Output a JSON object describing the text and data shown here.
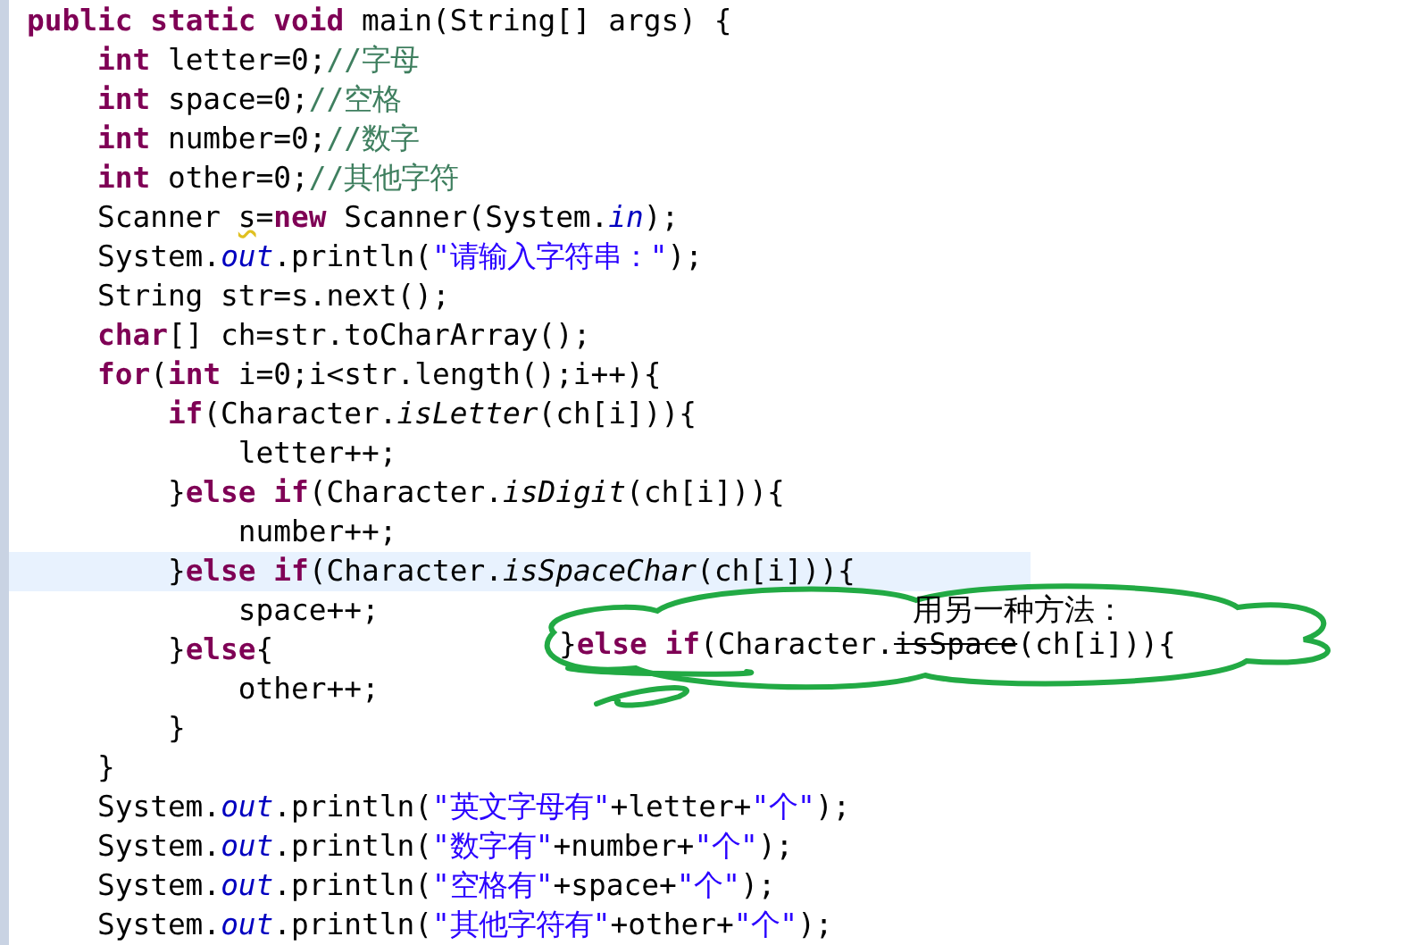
{
  "editor": {
    "lines": [
      {
        "current": false,
        "tokens": [
          {
            "kind": "keyword",
            "text": "public"
          },
          {
            "kind": "keyword",
            "text": " static"
          },
          {
            "kind": "keyword",
            "text": " void"
          },
          {
            "kind": "plain",
            "text": " main(String[] args) {"
          }
        ]
      },
      {
        "current": false,
        "tokens": [
          {
            "kind": "keyword",
            "text": "    int"
          },
          {
            "kind": "plain",
            "text": " letter=0;"
          },
          {
            "kind": "comment",
            "text": "//字母"
          }
        ]
      },
      {
        "current": false,
        "tokens": [
          {
            "kind": "keyword",
            "text": "    int"
          },
          {
            "kind": "plain",
            "text": " space=0;"
          },
          {
            "kind": "comment",
            "text": "//空格"
          }
        ]
      },
      {
        "current": false,
        "tokens": [
          {
            "kind": "keyword",
            "text": "    int"
          },
          {
            "kind": "plain",
            "text": " number=0;"
          },
          {
            "kind": "comment",
            "text": "//数字"
          }
        ]
      },
      {
        "current": false,
        "tokens": [
          {
            "kind": "keyword",
            "text": "    int"
          },
          {
            "kind": "plain",
            "text": " other=0;"
          },
          {
            "kind": "comment",
            "text": "//其他字符"
          }
        ]
      },
      {
        "current": false,
        "tokens": [
          {
            "kind": "plain",
            "text": "    Scanner "
          },
          {
            "kind": "warning",
            "text": "s"
          },
          {
            "kind": "plain",
            "text": "="
          },
          {
            "kind": "keyword",
            "text": "new"
          },
          {
            "kind": "plain",
            "text": " Scanner(System."
          },
          {
            "kind": "field",
            "text": "in"
          },
          {
            "kind": "plain",
            "text": ");"
          }
        ]
      },
      {
        "current": false,
        "tokens": [
          {
            "kind": "plain",
            "text": "    System."
          },
          {
            "kind": "field",
            "text": "out"
          },
          {
            "kind": "plain",
            "text": ".println("
          },
          {
            "kind": "string",
            "text": "\"请输入字符串：\""
          },
          {
            "kind": "plain",
            "text": ");"
          }
        ]
      },
      {
        "current": false,
        "tokens": [
          {
            "kind": "plain",
            "text": "    String str=s.next();"
          }
        ]
      },
      {
        "current": false,
        "tokens": [
          {
            "kind": "keyword",
            "text": "    char"
          },
          {
            "kind": "plain",
            "text": "[] ch=str.toCharArray();"
          }
        ]
      },
      {
        "current": false,
        "tokens": [
          {
            "kind": "keyword",
            "text": "    for"
          },
          {
            "kind": "plain",
            "text": "("
          },
          {
            "kind": "keyword",
            "text": "int"
          },
          {
            "kind": "plain",
            "text": " i=0;i<str.length();i++){"
          }
        ]
      },
      {
        "current": false,
        "tokens": [
          {
            "kind": "keyword",
            "text": "        if"
          },
          {
            "kind": "plain",
            "text": "(Character."
          },
          {
            "kind": "method",
            "text": "isLetter"
          },
          {
            "kind": "plain",
            "text": "(ch[i])){"
          }
        ]
      },
      {
        "current": false,
        "tokens": [
          {
            "kind": "plain",
            "text": "            letter++;"
          }
        ]
      },
      {
        "current": false,
        "tokens": [
          {
            "kind": "plain",
            "text": "        }"
          },
          {
            "kind": "keyword",
            "text": "else"
          },
          {
            "kind": "keyword",
            "text": " if"
          },
          {
            "kind": "plain",
            "text": "(Character."
          },
          {
            "kind": "method",
            "text": "isDigit"
          },
          {
            "kind": "plain",
            "text": "(ch[i])){"
          }
        ]
      },
      {
        "current": false,
        "tokens": [
          {
            "kind": "plain",
            "text": "            number++;"
          }
        ]
      },
      {
        "current": true,
        "tokens": [
          {
            "kind": "plain",
            "text": "        }"
          },
          {
            "kind": "keyword",
            "text": "else"
          },
          {
            "kind": "keyword",
            "text": " if"
          },
          {
            "kind": "plain",
            "text": "(Character."
          },
          {
            "kind": "method",
            "text": "isSpaceChar"
          },
          {
            "kind": "plain",
            "text": "(ch[i])){"
          }
        ]
      },
      {
        "current": false,
        "tokens": [
          {
            "kind": "plain",
            "text": "            space++;"
          }
        ]
      },
      {
        "current": false,
        "tokens": [
          {
            "kind": "plain",
            "text": "        }"
          },
          {
            "kind": "keyword",
            "text": "else"
          },
          {
            "kind": "plain",
            "text": "{"
          }
        ]
      },
      {
        "current": false,
        "tokens": [
          {
            "kind": "plain",
            "text": "            other++;"
          }
        ]
      },
      {
        "current": false,
        "tokens": [
          {
            "kind": "plain",
            "text": "        }"
          }
        ]
      },
      {
        "current": false,
        "tokens": [
          {
            "kind": "plain",
            "text": "    }"
          }
        ]
      },
      {
        "current": false,
        "tokens": [
          {
            "kind": "plain",
            "text": "    System."
          },
          {
            "kind": "field",
            "text": "out"
          },
          {
            "kind": "plain",
            "text": ".println("
          },
          {
            "kind": "string",
            "text": "\"英文字母有\""
          },
          {
            "kind": "plain",
            "text": "+letter+"
          },
          {
            "kind": "string",
            "text": "\"个\""
          },
          {
            "kind": "plain",
            "text": ");"
          }
        ]
      },
      {
        "current": false,
        "tokens": [
          {
            "kind": "plain",
            "text": "    System."
          },
          {
            "kind": "field",
            "text": "out"
          },
          {
            "kind": "plain",
            "text": ".println("
          },
          {
            "kind": "string",
            "text": "\"数字有\""
          },
          {
            "kind": "plain",
            "text": "+number+"
          },
          {
            "kind": "string",
            "text": "\"个\""
          },
          {
            "kind": "plain",
            "text": ");"
          }
        ]
      },
      {
        "current": false,
        "tokens": [
          {
            "kind": "plain",
            "text": "    System."
          },
          {
            "kind": "field",
            "text": "out"
          },
          {
            "kind": "plain",
            "text": ".println("
          },
          {
            "kind": "string",
            "text": "\"空格有\""
          },
          {
            "kind": "plain",
            "text": "+space+"
          },
          {
            "kind": "string",
            "text": "\"个\""
          },
          {
            "kind": "plain",
            "text": ");"
          }
        ]
      },
      {
        "current": false,
        "tokens": [
          {
            "kind": "plain",
            "text": "    System."
          },
          {
            "kind": "field",
            "text": "out"
          },
          {
            "kind": "plain",
            "text": ".println("
          },
          {
            "kind": "string",
            "text": "\"其他字符有\""
          },
          {
            "kind": "plain",
            "text": "+other+"
          },
          {
            "kind": "string",
            "text": "\"个\""
          },
          {
            "kind": "plain",
            "text": ");"
          }
        ]
      }
    ]
  },
  "annotation": {
    "note": "用另一种方法：",
    "code": [
      {
        "kind": "plain",
        "text": "}"
      },
      {
        "kind": "keyword",
        "text": "else"
      },
      {
        "kind": "keyword",
        "text": " if"
      },
      {
        "kind": "plain",
        "text": "(Character."
      },
      {
        "kind": "struck",
        "text": "isSpace"
      },
      {
        "kind": "plain",
        "text": "(ch[i])){"
      }
    ]
  }
}
